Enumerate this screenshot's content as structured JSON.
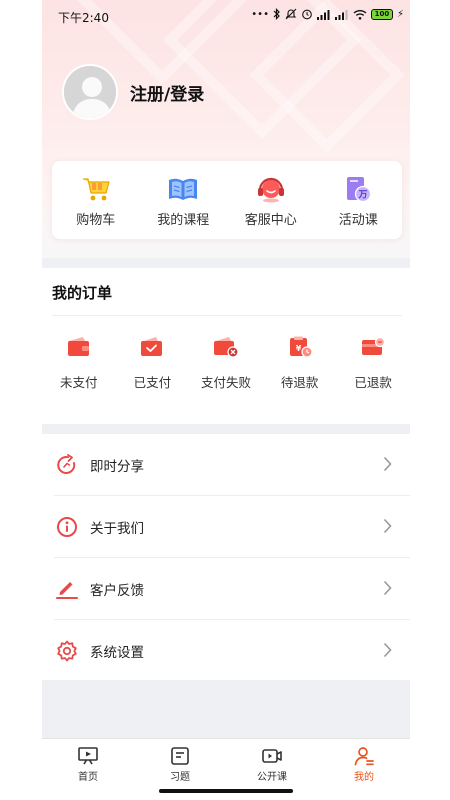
{
  "status_bar": {
    "time": "下午2:40",
    "battery": "100"
  },
  "profile": {
    "login_label": "注册/登录"
  },
  "quick_links": [
    {
      "label": "购物车",
      "icon": "shopping-cart-icon"
    },
    {
      "label": "我的课程",
      "icon": "open-book-icon"
    },
    {
      "label": "客服中心",
      "icon": "headset-icon"
    },
    {
      "label": "活动课",
      "icon": "activity-course-icon"
    }
  ],
  "orders": {
    "title": "我的订单",
    "items": [
      {
        "label": "未支付",
        "icon": "wallet-unpaid-icon"
      },
      {
        "label": "已支付",
        "icon": "wallet-paid-icon"
      },
      {
        "label": "支付失败",
        "icon": "wallet-failed-icon"
      },
      {
        "label": "待退款",
        "icon": "pending-refund-icon"
      },
      {
        "label": "已退款",
        "icon": "refunded-card-icon"
      }
    ]
  },
  "menu": [
    {
      "label": "即时分享",
      "icon": "share-icon"
    },
    {
      "label": "关于我们",
      "icon": "info-icon"
    },
    {
      "label": "客户反馈",
      "icon": "pen-feedback-icon"
    },
    {
      "label": "系统设置",
      "icon": "gear-icon"
    }
  ],
  "tabs": [
    {
      "label": "首页",
      "icon": "home-presentation-icon",
      "active": false
    },
    {
      "label": "习题",
      "icon": "exercise-list-icon",
      "active": false
    },
    {
      "label": "公开课",
      "icon": "video-camera-icon",
      "active": false
    },
    {
      "label": "我的",
      "icon": "user-profile-icon",
      "active": true
    }
  ],
  "colors": {
    "accent": "#e8561f",
    "brand_red": "#e84a4a",
    "page_gray": "#eef0f3"
  }
}
